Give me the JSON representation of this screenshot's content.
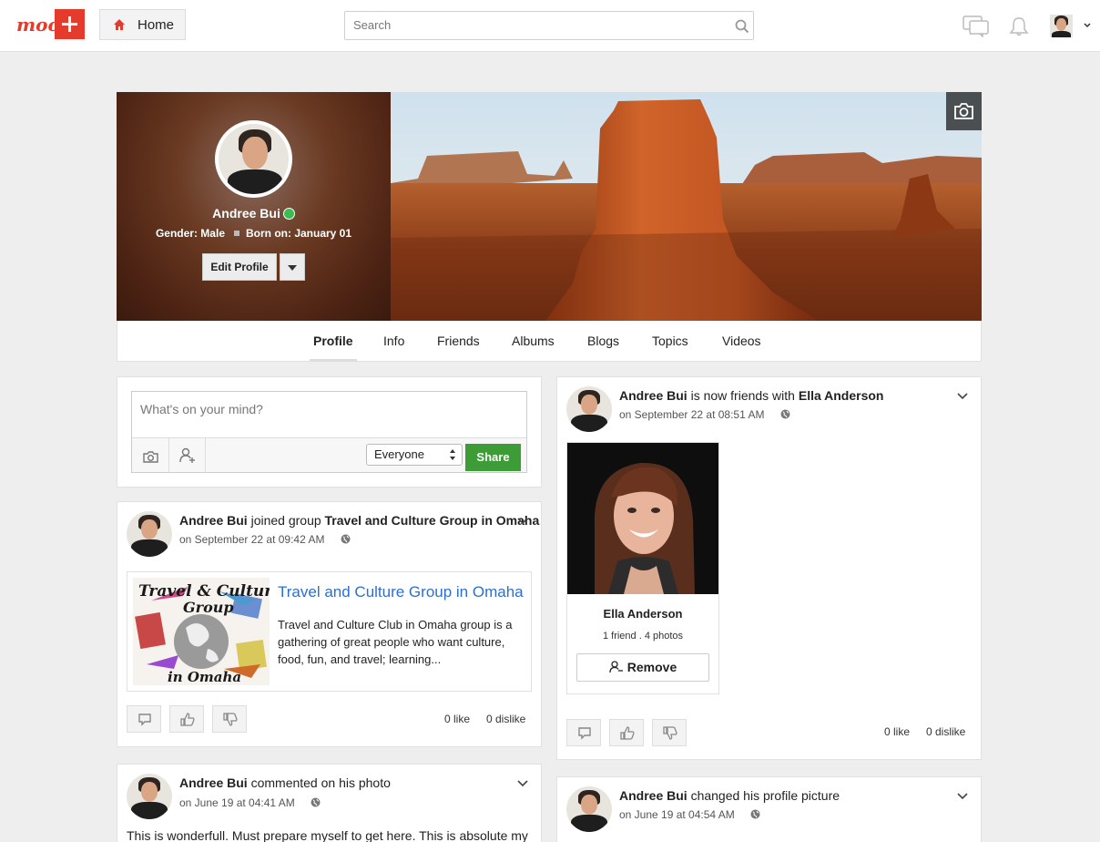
{
  "header": {
    "logo_text": "moo",
    "home_label": "Home",
    "search_placeholder": "Search"
  },
  "profile": {
    "name": "Andree Bui",
    "gender": "Gender: Male",
    "born": "Born on: January 01",
    "edit_label": "Edit Profile"
  },
  "tabs": [
    "Profile",
    "Info",
    "Friends",
    "Albums",
    "Blogs",
    "Topics",
    "Videos"
  ],
  "composer": {
    "placeholder": "What's on your mind?",
    "privacy": "Everyone",
    "share_label": "Share"
  },
  "posts": {
    "group_join": {
      "actor": "Andree Bui",
      "verb": "joined group",
      "target": "Travel and Culture Group in Omaha",
      "time": "on September 22 at 09:42 AM",
      "group_title": "Travel and Culture Group in Omaha",
      "group_desc": "Travel and Culture Club in Omaha group is a gathering of great people who want culture, food, fun, and travel; learning...",
      "likes": "0  like",
      "dislikes": "0  dislike"
    },
    "friends": {
      "actor": "Andree Bui",
      "verb": "is now friends with",
      "target": "Ella Anderson",
      "time": "on September 22 at 08:51 AM",
      "friend_name": "Ella Anderson",
      "friend_meta": "1 friend . 4 photos",
      "remove_label": "Remove",
      "likes": "0  like",
      "dislikes": "0  dislike"
    },
    "comment": {
      "actor": "Andree Bui",
      "verb": "commented on his photo",
      "time": "on June 19 at 04:41 AM",
      "text": "This is wonderfull. Must prepare myself to get here. This is absolute my"
    },
    "profile_pic": {
      "actor": "Andree Bui",
      "verb": "changed his profile picture",
      "time": "on June 19 at 04:54 AM"
    }
  },
  "colors": {
    "brand": "#e53b2c",
    "share": "#3d9c35",
    "link": "#2b6fd6",
    "online": "#3cbb52"
  }
}
